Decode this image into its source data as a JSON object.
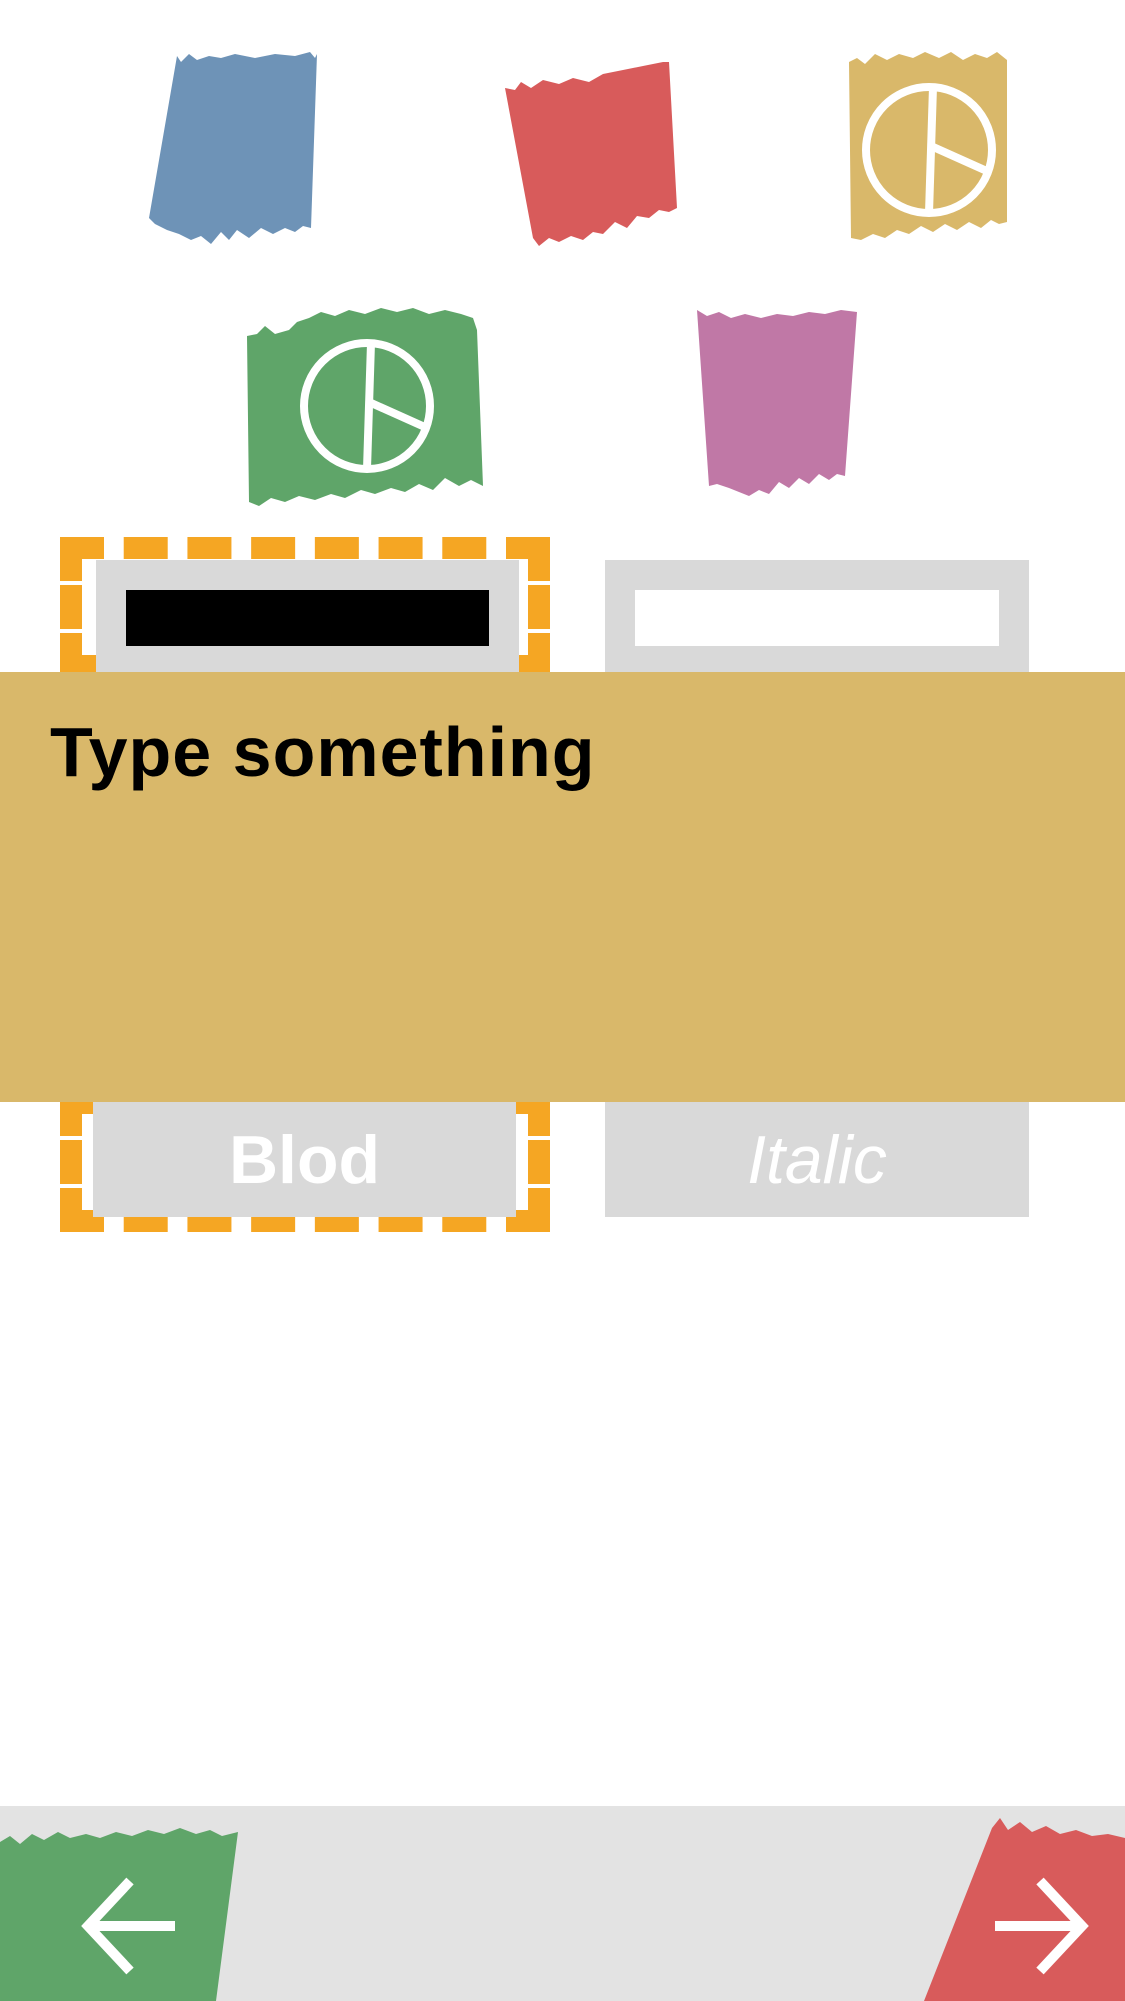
{
  "palette": {
    "items": [
      {
        "name": "blue-swatch",
        "color": "#6E93B7",
        "icon": ""
      },
      {
        "name": "red-swatch",
        "color": "#D85B5B",
        "icon": ""
      },
      {
        "name": "yellow-swatch",
        "color": "#D9B86A",
        "icon": "peace-icon"
      },
      {
        "name": "green-swatch",
        "color": "#5FA569",
        "icon": "peace-icon"
      },
      {
        "name": "pink-swatch",
        "color": "#C078A6",
        "icon": ""
      }
    ]
  },
  "text_color_options": [
    {
      "label": "black",
      "color": "#000000",
      "selected": true
    },
    {
      "label": "white",
      "color": "#FFFFFF",
      "selected": false
    }
  ],
  "editor": {
    "text": "Type something",
    "background": "#D9B86A"
  },
  "style_buttons": {
    "bold_label": "Blod",
    "italic_label": "Italic",
    "selected": "bold"
  },
  "navigation": {
    "back_icon": "arrow-left-icon",
    "next_icon": "arrow-right-icon",
    "back_color": "#5FA569",
    "next_color": "#D85B5B"
  },
  "colors": {
    "selection_outline": "#F5A623",
    "control_gray": "#D9D9D9",
    "bottom_bar": "#E3E3E3"
  }
}
